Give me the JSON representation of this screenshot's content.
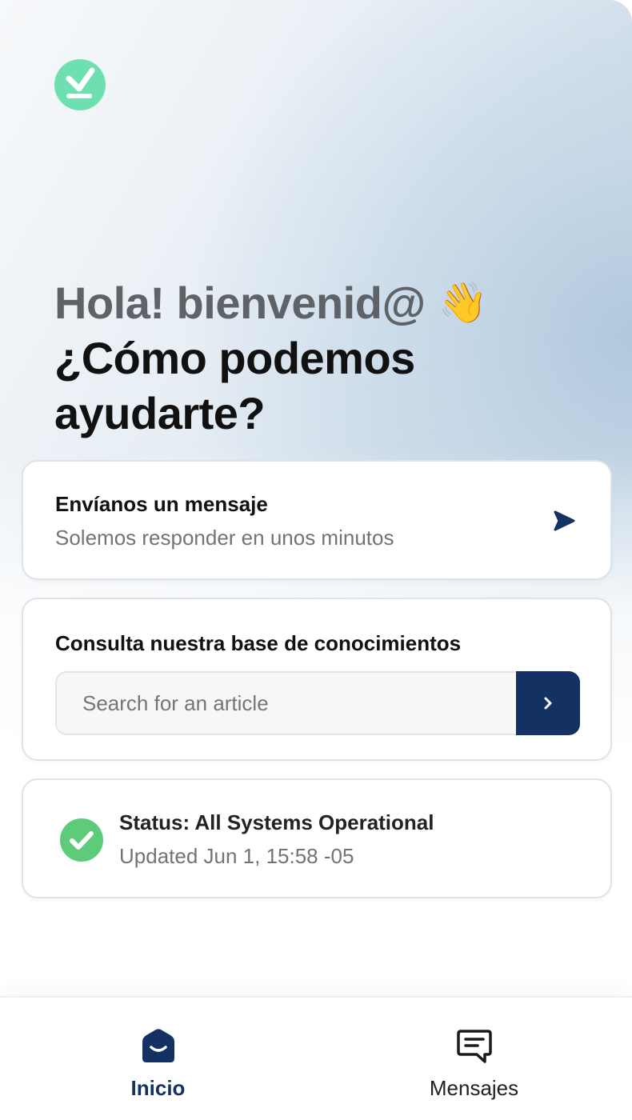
{
  "brand": {
    "logo": "download-check-icon",
    "logo_color": "#6ee0b0"
  },
  "greeting": {
    "hello": "Hola! bienvenid@",
    "wave_emoji": "👋",
    "question": "¿Cómo podemos ayudarte?"
  },
  "message_card": {
    "title": "Envíanos un mensaje",
    "subtitle": "Solemos responder en unos minutos",
    "icon": "send-icon"
  },
  "knowledge_card": {
    "title": "Consulta nuestra base de conocimientos",
    "search_placeholder": "Search for an article",
    "search_value": "",
    "search_button_icon": "chevron-right-icon"
  },
  "status_card": {
    "title": "Status: All Systems Operational",
    "updated": "Updated Jun 1, 15:58 -05",
    "icon": "check-circle-icon",
    "status_color": "#5ecb7a"
  },
  "nav": {
    "items": [
      {
        "label": "Inicio",
        "icon": "home-icon",
        "active": true
      },
      {
        "label": "Mensajes",
        "icon": "messages-icon",
        "active": false
      }
    ]
  },
  "colors": {
    "accent": "#133263",
    "muted_text": "#737373"
  }
}
